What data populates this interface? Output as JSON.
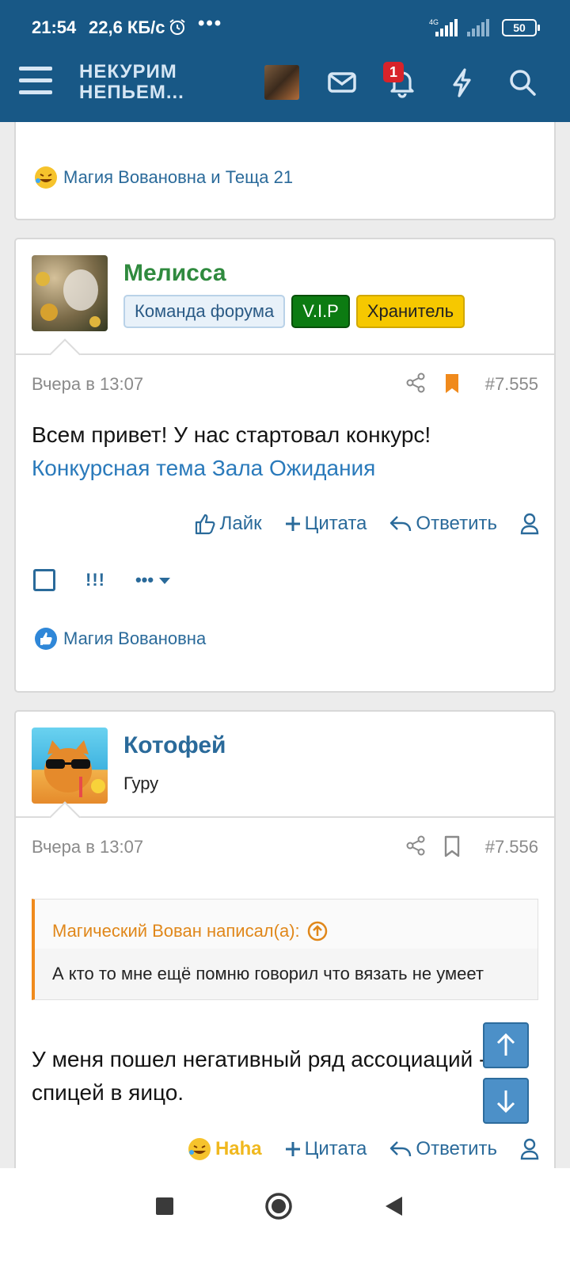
{
  "status_bar": {
    "time": "21:54",
    "speed": "22,6 КБ/с",
    "dots": "•••",
    "network": "4G",
    "battery": "50"
  },
  "header": {
    "logo_line1": "НЕКУРИМ",
    "logo_line2": "НЕПЬЕМ...",
    "notification_count": "1"
  },
  "post_top": {
    "reactions": "Магия Вовановна и Теща 21"
  },
  "post_melissa": {
    "username": "Мелисса",
    "badges": [
      "Команда форума",
      "V.I.P",
      "Хранитель"
    ],
    "date": "Вчера в 13:07",
    "number": "#7.555",
    "text": "Всем привет! У нас стартовал конкурс!",
    "link": "Конкурсная тема Зала Ожидания",
    "actions": {
      "like": "Лайк",
      "quote": "Цитата",
      "reply": "Ответить"
    },
    "tools": {
      "bangs": "!!!",
      "more": "•••"
    },
    "reactions": "Магия Вовановна"
  },
  "post_kotofey": {
    "username": "Котофей",
    "title": "Гуру",
    "date": "Вчера в 13:07",
    "number": "#7.556",
    "quote_author": "Магический Вован написал(а):",
    "quote_text": "А кто то мне ещё помню говорил что вязать не умеет",
    "text": "У меня пошел негативный ряд ассоциаций - спицей в яицо.",
    "actions": {
      "haha": "Haha",
      "quote": "Цитата",
      "reply": "Ответить"
    }
  },
  "colors": {
    "header_bg": "#185886",
    "link": "#2a7abb",
    "username_green": "#2f8a3e",
    "vip": "#0c7b12",
    "keeper": "#f6c800",
    "bookmark_active": "#f08a1c",
    "quote_accent": "#f08a1c"
  }
}
